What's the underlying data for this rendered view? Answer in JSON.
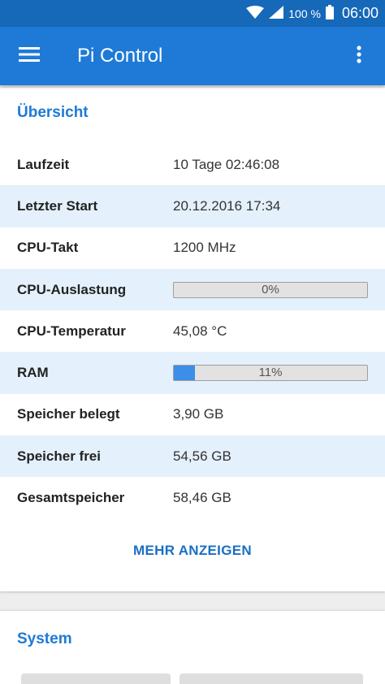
{
  "status_bar": {
    "battery": "100 %",
    "time": "06:00",
    "icons": [
      "wifi-icon",
      "signal-icon",
      "battery-icon"
    ]
  },
  "app_bar": {
    "title": "Pi Control",
    "menu_icon": "menu-icon",
    "overflow_icon": "more-vert-icon"
  },
  "overview": {
    "title": "Übersicht",
    "rows": [
      {
        "label": "Laufzeit",
        "value": "10 Tage 02:46:08"
      },
      {
        "label": "Letzter Start",
        "value": "20.12.2016 17:34"
      },
      {
        "label": "CPU-Takt",
        "value": "1200 MHz"
      },
      {
        "label": "CPU-Auslastung",
        "progress_text": "0%",
        "progress": 0
      },
      {
        "label": "CPU-Temperatur",
        "value": "45,08 °C"
      },
      {
        "label": "RAM",
        "progress_text": "11%",
        "progress": 0.11
      },
      {
        "label": "Speicher belegt",
        "value": "3,90 GB"
      },
      {
        "label": "Speicher frei",
        "value": "54,56 GB"
      },
      {
        "label": "Gesamtspeicher",
        "value": "58,46 GB"
      }
    ],
    "more_label": "MEHR ANZEIGEN"
  },
  "system": {
    "title": "System"
  },
  "colors": {
    "status_bar": "#1668b8",
    "app_bar": "#1e7ad6",
    "accent": "#1e7ad6",
    "row_shade": "#e4f0fb",
    "progress_fill": "#3d8ee6"
  }
}
